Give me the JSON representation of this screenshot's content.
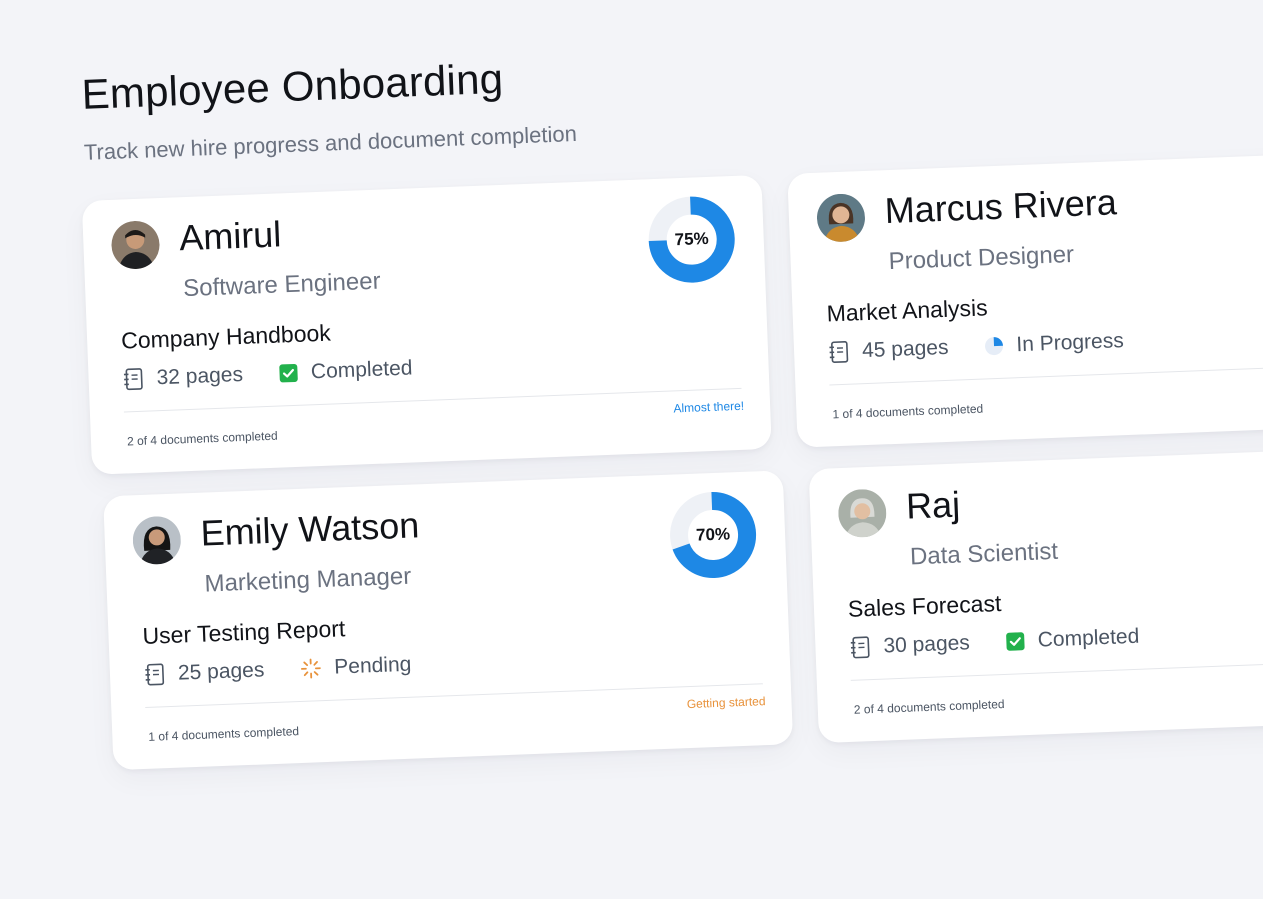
{
  "header": {
    "title": "Employee Onboarding",
    "subtitle": "Track new hire progress and document completion"
  },
  "colors": {
    "accent_blue": "#1e88e5",
    "ring_track": "#eef1f6",
    "completed_green": "#22b14c",
    "pending_orange": "#e8923b",
    "muted_text": "#6b7280"
  },
  "cards": [
    {
      "name": "Amirul",
      "role": "Software Engineer",
      "document": "Company Handbook",
      "pages": "32 pages",
      "status": "Completed",
      "status_icon": "checkbox-checked-icon",
      "progress_text": "75%",
      "progress_value": 0.75,
      "docs_completed": "2 of 4 documents completed",
      "footer_note": "Almost there!",
      "footer_note_color": "#1e88e5"
    },
    {
      "name": "Marcus Rivera",
      "role": "Product Designer",
      "document": "Market Analysis",
      "pages": "45 pages",
      "status": "In Progress",
      "status_icon": "pie-progress-icon",
      "docs_completed": "1 of 4 documents completed"
    },
    {
      "name": "Emily Watson",
      "role": "Marketing Manager",
      "document": "User Testing Report",
      "pages": "25 pages",
      "status": "Pending",
      "status_icon": "loading-spinner-icon",
      "progress_text": "70%",
      "progress_value": 0.7,
      "docs_completed": "1 of 4 documents completed",
      "footer_note": "Getting started",
      "footer_note_color": "#e8923b"
    },
    {
      "name": "Raj",
      "role": "Data Scientist",
      "document": "Sales Forecast",
      "pages": "30 pages",
      "status": "Completed",
      "status_icon": "checkbox-checked-icon",
      "docs_completed": "2 of 4 documents completed"
    }
  ]
}
